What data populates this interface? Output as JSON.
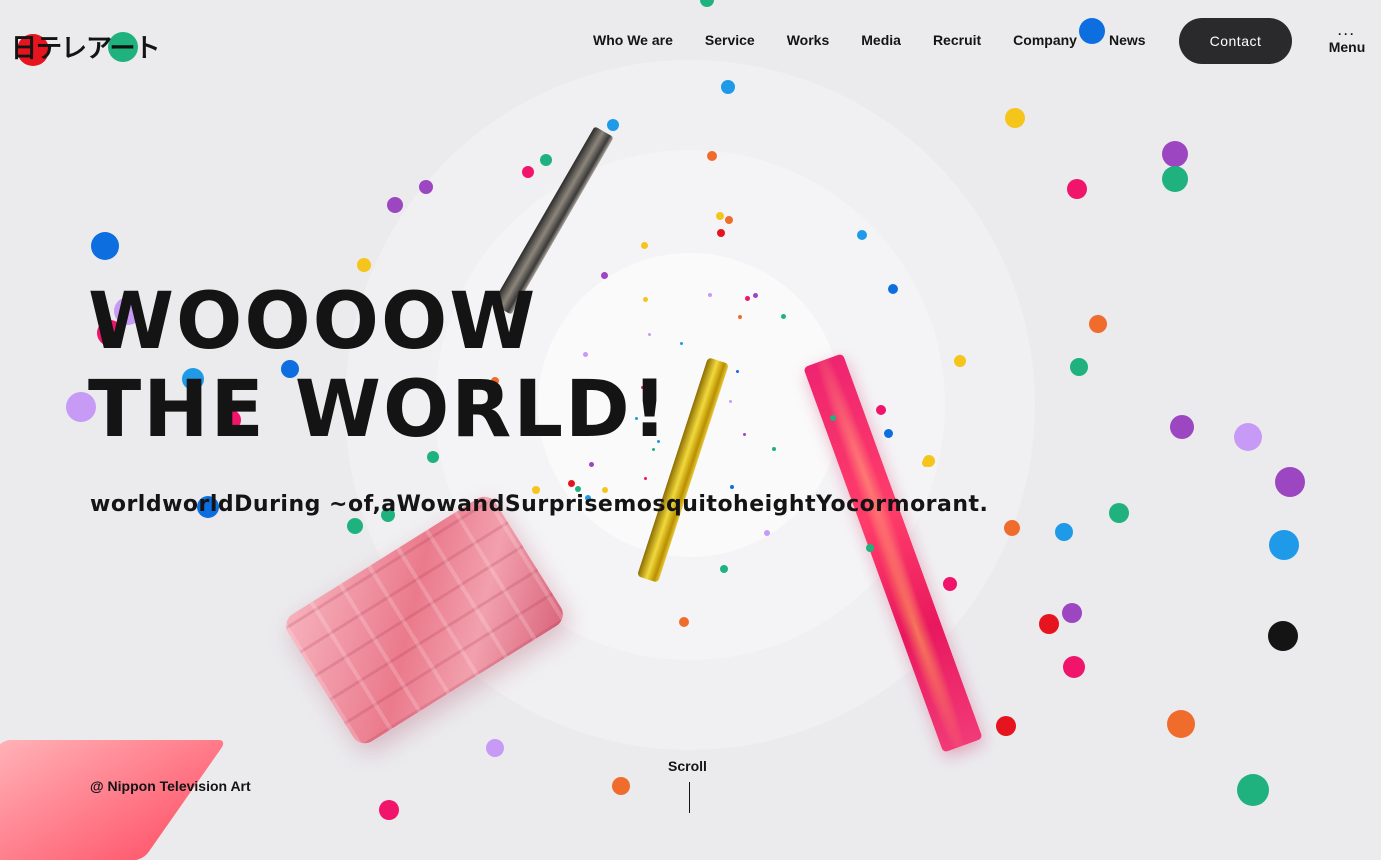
{
  "header": {
    "logo_text": "日テレアート",
    "nav": [
      "Who We are",
      "Service",
      "Works",
      "Media",
      "Recruit",
      "Company",
      "News"
    ],
    "contact_label": "Contact",
    "menu_dots": "···",
    "menu_label": "Menu"
  },
  "hero": {
    "title_line1": "WOOOOW",
    "title_line2": "THE WORLD!",
    "tagline": "worldworldDuring ~of,aWowandSurprisemosquitoheightYocormorant."
  },
  "footer": {
    "scroll_label": "Scroll",
    "copyright": "@ Nippon Television Art"
  },
  "colors": {
    "background": "#ebebee",
    "text": "#141414",
    "contact_button": "#2a2a2c",
    "confetti": [
      "#e6141e",
      "#1fb27f",
      "#0d6ee0",
      "#1f9ae8",
      "#f06c2c",
      "#f5c51b",
      "#9d46c1",
      "#c79bf5",
      "#f0146a",
      "#141414"
    ]
  }
}
